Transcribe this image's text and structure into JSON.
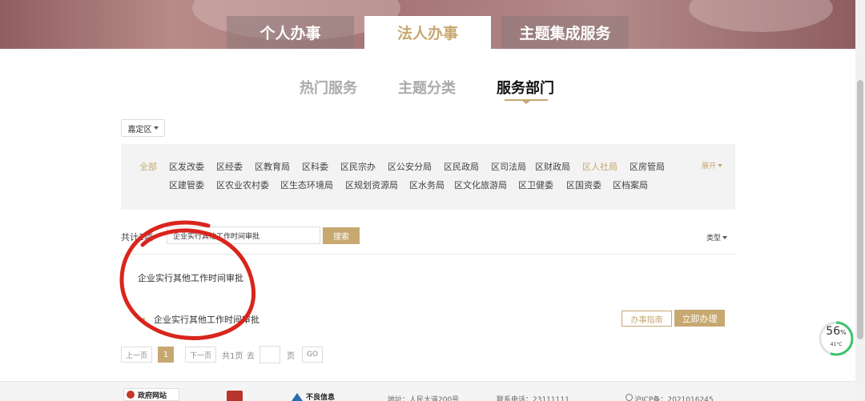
{
  "main_tabs": [
    {
      "label": "个人办事",
      "active": false
    },
    {
      "label": "法人办事",
      "active": true
    },
    {
      "label": "主题集成服务",
      "active": false
    }
  ],
  "sub_tabs": [
    {
      "label": "热门服务",
      "active": false
    },
    {
      "label": "主题分类",
      "active": false
    },
    {
      "label": "服务部门",
      "active": true
    }
  ],
  "district": {
    "selected": "嘉定区"
  },
  "departments": {
    "row1": [
      "全部",
      "区发改委",
      "区经委",
      "区教育局",
      "区科委",
      "区民宗办",
      "区公安分局",
      "区民政局",
      "区司法局",
      "区财政局",
      "区人社局",
      "区房管局"
    ],
    "row2": [
      "区建管委",
      "区农业农村委",
      "区生态环境局",
      "区规划资源局",
      "区水务局",
      "区文化旅游局",
      "区卫健委",
      "区国资委",
      "区档案局"
    ],
    "expand_label": "展开"
  },
  "search": {
    "total_label": "共计1项",
    "value": "企业实行其他工作时间审批",
    "button_label": "搜索",
    "type_filter": "类型"
  },
  "results": {
    "group_title": "企业实行其他工作时间审批",
    "items": [
      {
        "title": "企业实行其他工作时间审批",
        "guide_label": "办事指南",
        "apply_label": "立即办理"
      }
    ]
  },
  "pagination": {
    "prev": "上一页",
    "current": "1",
    "next": "下一页",
    "total": "共1页",
    "goto": "去",
    "page_suffix": "页",
    "go": "GO"
  },
  "widget": {
    "percent": "56",
    "percent_unit": "%",
    "temperature": "41°C"
  },
  "footer": {
    "logo_text": "政府网站",
    "brand_text": "不良信息",
    "address": "地址：人民大道200号",
    "phone": "联系电话：23111111",
    "icp": "沪ICP备：2021016245"
  },
  "colors": {
    "accent": "#c7a871",
    "annotation": "#d9251c"
  }
}
